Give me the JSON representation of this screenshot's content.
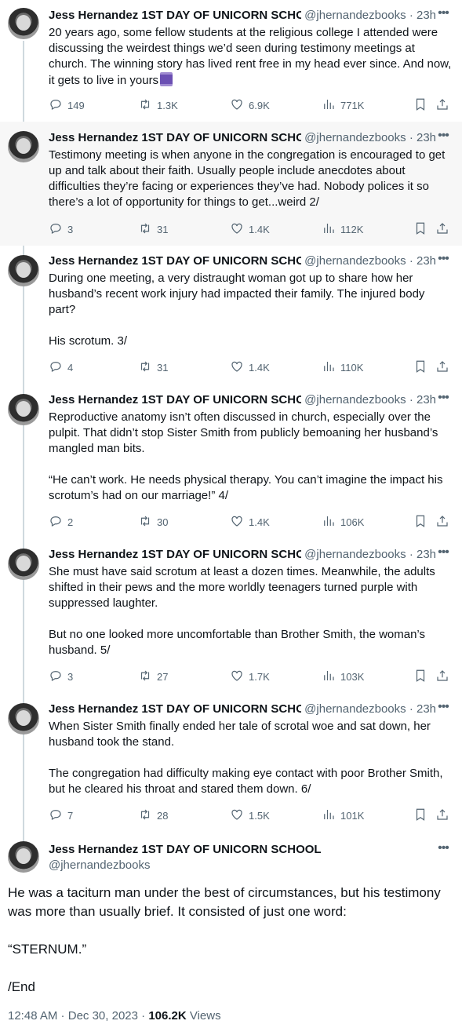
{
  "author": {
    "name": "Jess Hernandez 1ST DAY OF UNICORN SCHOOL",
    "handle": "@jhernandezbooks",
    "time": "23h"
  },
  "tweets": [
    {
      "text": "20 years ago, some fellow students at the religious college I attended were discussing the weirdest things we’d seen during testimony meetings at church. The winning story has lived rent free in my head ever since. And now, it gets to live in yours",
      "emoji": "spool-of-thread",
      "replies": "149",
      "retweets": "1.3K",
      "likes": "6.9K",
      "views": "771K"
    },
    {
      "text": "Testimony meeting is when anyone in the congregation is encouraged to get up and talk about their faith. Usually people include anecdotes about difficulties they’re facing or experiences they’ve had. Nobody polices it so there’s a lot of opportunity for things to get...weird 2/",
      "replies": "3",
      "retweets": "31",
      "likes": "1.4K",
      "views": "112K"
    },
    {
      "text": "During one meeting, a very distraught woman got up to share how her husband’s recent work injury had impacted their family. The injured body part?\n\nHis scrotum. 3/",
      "replies": "4",
      "retweets": "31",
      "likes": "1.4K",
      "views": "110K"
    },
    {
      "text": "Reproductive anatomy isn’t often discussed in church, especially over the pulpit. That didn’t stop Sister Smith from publicly bemoaning her husband’s mangled man bits.\n\n“He can’t work. He needs physical therapy. You can’t imagine the impact his scrotum’s had on our marriage!” 4/",
      "replies": "2",
      "retweets": "30",
      "likes": "1.4K",
      "views": "106K"
    },
    {
      "text": "She must have said scrotum at least a dozen times. Meanwhile, the adults shifted in their pews and the more worldly teenagers turned purple with suppressed laughter.\n\nBut no one looked more uncomfortable than Brother Smith, the woman’s husband. 5/",
      "replies": "3",
      "retweets": "27",
      "likes": "1.7K",
      "views": "103K"
    },
    {
      "text": "When Sister Smith finally ended her tale of scrotal woe and sat down, her husband took the stand.\n\nThe congregation had difficulty making eye contact with poor Brother Smith, but he cleared his throat and stared them down. 6/",
      "replies": "7",
      "retweets": "28",
      "likes": "1.5K",
      "views": "101K"
    }
  ],
  "main": {
    "text": "He was a taciturn man under the best of circumstances, but his testimony was more than usually brief. It consisted of just one word:\n\n“STERNUM.”\n\n/End",
    "time": "12:48 AM",
    "date": "Dec 30, 2023",
    "views_count": "106.2K",
    "views_label": "Views"
  },
  "icons": [
    "reply-icon",
    "retweet-icon",
    "like-icon",
    "views-icon",
    "bookmark-icon",
    "share-icon",
    "more-icon"
  ],
  "colors": {
    "text": "#0f1419",
    "secondary": "#536471",
    "highlight_bg": "#f7f7f7",
    "thread_line": "#cfd9de"
  }
}
